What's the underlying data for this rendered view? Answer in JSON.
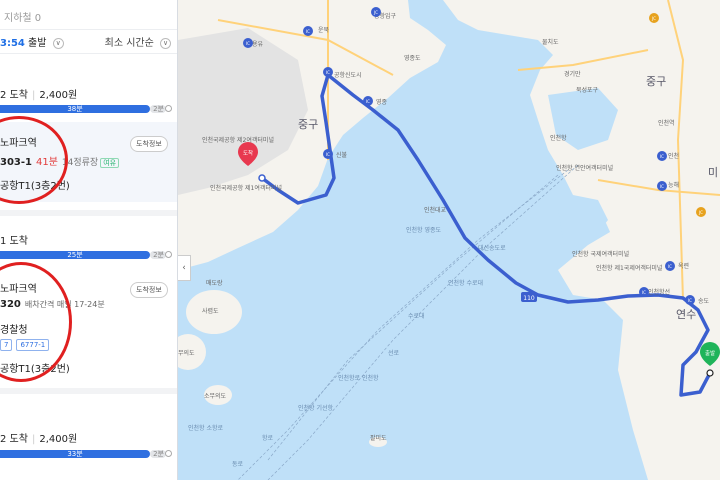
{
  "panel": {
    "top_text": "지하철 0",
    "departure_time": "3:54",
    "departure_suffix": " 출발",
    "sort_label": "최소 시간순"
  },
  "routes": [
    {
      "arrival_time": "2 도착",
      "fare": "2,400원",
      "bar_main": "38분",
      "bar_tail": "2분",
      "station": "노파크역",
      "info_button": "도착정보",
      "bus_number": "303-1",
      "wait_minutes": "41분",
      "stops": "14정류장",
      "status_tag": "여유",
      "destination": "공항T1(3층2번)"
    },
    {
      "arrival_time": "1 도착",
      "bar_main": "25분",
      "bar_tail": "2분",
      "station": "노파크역",
      "info_button": "도착정보",
      "bus_number": "320",
      "interval": "배차간격 매일 17-24분",
      "transfer_station": "경찰청",
      "chips": [
        "7",
        "6777-1"
      ],
      "destination": "공항T1(3층2번)"
    },
    {
      "arrival_time": "2 도착",
      "fare": "2,400원",
      "bar_main": "33분",
      "bar_tail": "2분"
    }
  ],
  "map": {
    "route_color": "#3b5fcf",
    "marker_arrival_label": "도착",
    "marker_departure_label": "출발",
    "district_labels": [
      "중구",
      "중구",
      "미",
      "연수"
    ],
    "place_labels": [
      "인천대교",
      "공항신도시",
      "영종",
      "신불",
      "운북",
      "공항입구",
      "영종도",
      "물치도",
      "용유",
      "인천국제공항 제2여객터미널",
      "인천국제공항 제1여객터미널",
      "매도랑",
      "사렴도",
      "무의도",
      "소무의도",
      "팔미도",
      "인천항 영종도",
      "경기만",
      "북성포구",
      "인천",
      "인천역",
      "능해",
      "인천항 국제여객터미널",
      "인천항 연안여객터미널",
      "인천항 제1국제여객터미널",
      "송도",
      "옥련",
      "인천항선",
      "인천항",
      "대신송도로",
      "인천항 수로대",
      "수로대",
      "선로",
      "인천항로 인천항",
      "인천항 기선항",
      "항로",
      "동로",
      "인천항 소항로"
    ],
    "road_badges": [
      "IC",
      "JC",
      "IC",
      "IC",
      "IC",
      "IC",
      "IC",
      "JC",
      "IC",
      "JC",
      "IC",
      "IC",
      "IC"
    ],
    "highway_shield": "110",
    "collapse_arrow": "‹"
  }
}
